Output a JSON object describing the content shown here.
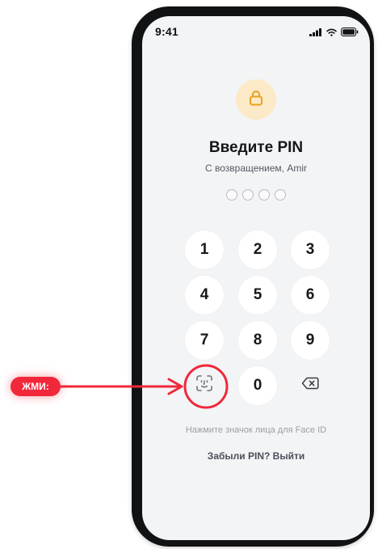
{
  "status_bar": {
    "time": "9:41",
    "signal_icon": "signal-icon",
    "wifi_icon": "wifi-icon",
    "battery_icon": "battery-icon"
  },
  "lock": {
    "icon": "lock-icon",
    "badge_color": "#fce9c8",
    "icon_color": "#e8a11a"
  },
  "title": "Введите PIN",
  "subtitle": "С возвращением, Amir",
  "pin_dots_count": 4,
  "keypad": {
    "keys": [
      "1",
      "2",
      "3",
      "4",
      "5",
      "6",
      "7",
      "8",
      "9",
      "0"
    ],
    "face_id_icon": "face-id-icon",
    "backspace_icon": "backspace-icon"
  },
  "hint": "Нажмите значок лица для Face ID",
  "forgot_link": "Забыли PIN? Выйти",
  "annotation": {
    "label": "ЖМИ:",
    "color": "#f0283a"
  }
}
